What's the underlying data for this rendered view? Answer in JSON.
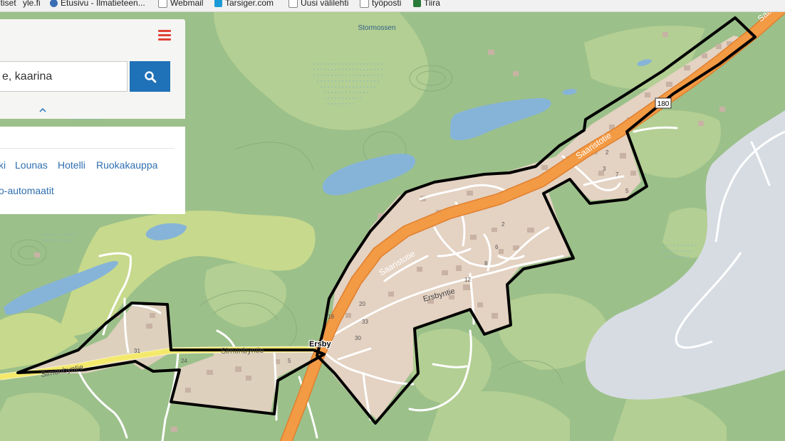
{
  "bookmarks": [
    {
      "label": "utiset",
      "icon": "none"
    },
    {
      "label": "yle.fi",
      "icon": "none"
    },
    {
      "label": "Etusivu - Ilmatieteen...",
      "icon": "globe-icon"
    },
    {
      "label": "Webmail",
      "icon": "page-icon"
    },
    {
      "label": "Tarsiger.com",
      "icon": "tarsiger-icon"
    },
    {
      "label": "Uusi välilehti",
      "icon": "page-icon"
    },
    {
      "label": "työposti",
      "icon": "page-icon"
    },
    {
      "label": "Tiira",
      "icon": "tiira-icon"
    }
  ],
  "panel": {
    "search_value": "e, kaarina",
    "menu_icon": "hamburger-menu-icon",
    "search_icon": "search-icon",
    "collapse_icon": "chevron-up-icon",
    "categories": [
      "ki",
      "Lounas",
      "Hotelli",
      "Ruokakauppa",
      "o-automaatit"
    ]
  },
  "map": {
    "labels": {
      "stormossen": "Stormossen",
      "saaristotie_1": "Saaristotie",
      "saaristotie_2": "Saaristotie",
      "saaristotie_3": "Saa",
      "ersbyntie": "Ersbyntie",
      "simonbyntie_1": "Simonbyntie",
      "simonbyntie_2": "Simonbyntie",
      "ersby": "Ersby",
      "road_number": "180",
      "hn_2": "2",
      "hn_6": "6",
      "hn_8": "8",
      "hn_12": "12",
      "hn_20": "20",
      "hn_3": "3",
      "hn_5": "5",
      "hn_2b": "2",
      "hn_7": "7",
      "hn_5b": "5",
      "hn_31": "31",
      "hn_24": "24",
      "hn_33": "33",
      "hn_30": "30",
      "hn_19": "19"
    },
    "colors": {
      "forest": "#9cc08a",
      "field": "#c9d98a",
      "water": "#86b4d8",
      "built": "#e4d2c2",
      "highway": "#f39a44",
      "local_road": "#f6f1c6",
      "boundary": "#000000",
      "sea": "#d7dce3"
    }
  }
}
